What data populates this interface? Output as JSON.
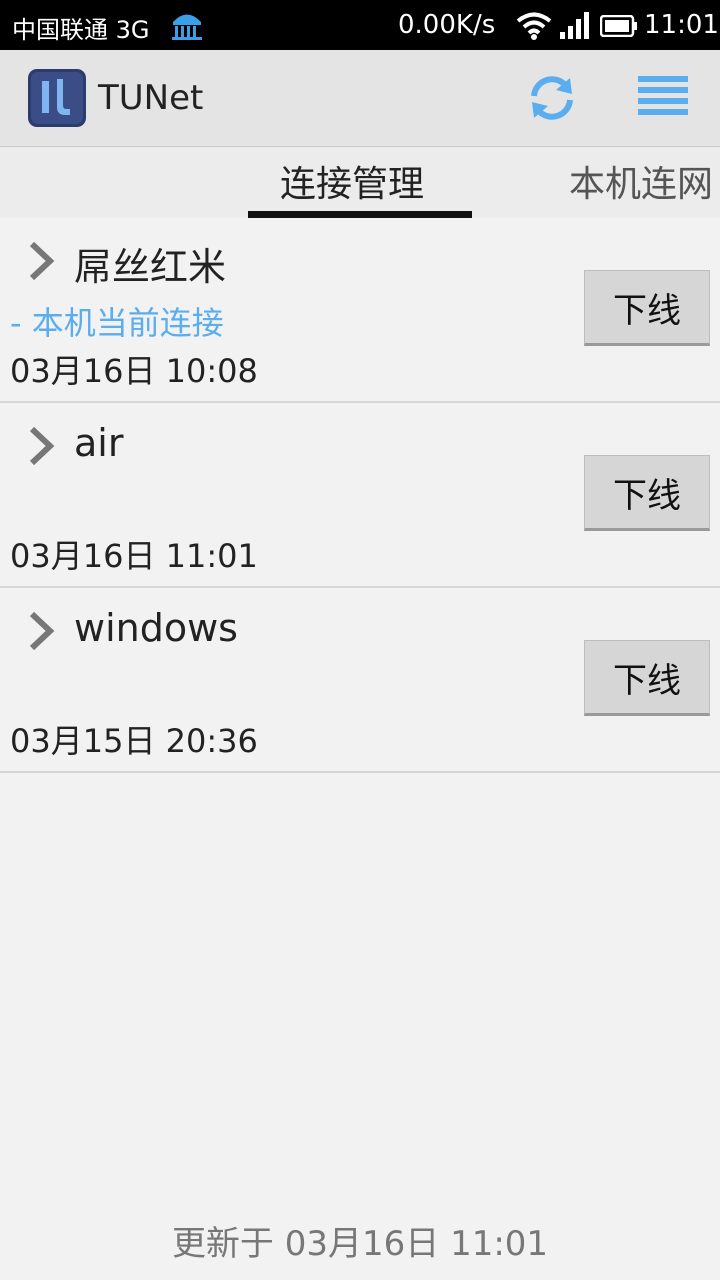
{
  "status_bar": {
    "carrier": "中国联通 3G",
    "network_speed": "0.00K/s",
    "time": "11:01",
    "icons": [
      "university-icon",
      "wifi-icon",
      "signal-icon",
      "battery-icon"
    ]
  },
  "app_bar": {
    "title": "TUNet",
    "icons": [
      "app-logo-icon",
      "refresh-icon",
      "menu-icon"
    ],
    "accent_color": "#5aaef0"
  },
  "tabs": [
    {
      "label": "连接管理",
      "selected": true
    },
    {
      "label": "本机连网",
      "selected": false
    }
  ],
  "connections": [
    {
      "name": "屌丝红米",
      "current_label": "- 本机当前连接",
      "time": "03月16日 10:08",
      "button_label": "下线"
    },
    {
      "name": "air",
      "current_label": "",
      "time": "03月16日 11:01",
      "button_label": "下线"
    },
    {
      "name": "windows",
      "current_label": "",
      "time": "03月15日 20:36",
      "button_label": "下线"
    }
  ],
  "footer": {
    "updated": "更新于 03月16日 11:01"
  }
}
